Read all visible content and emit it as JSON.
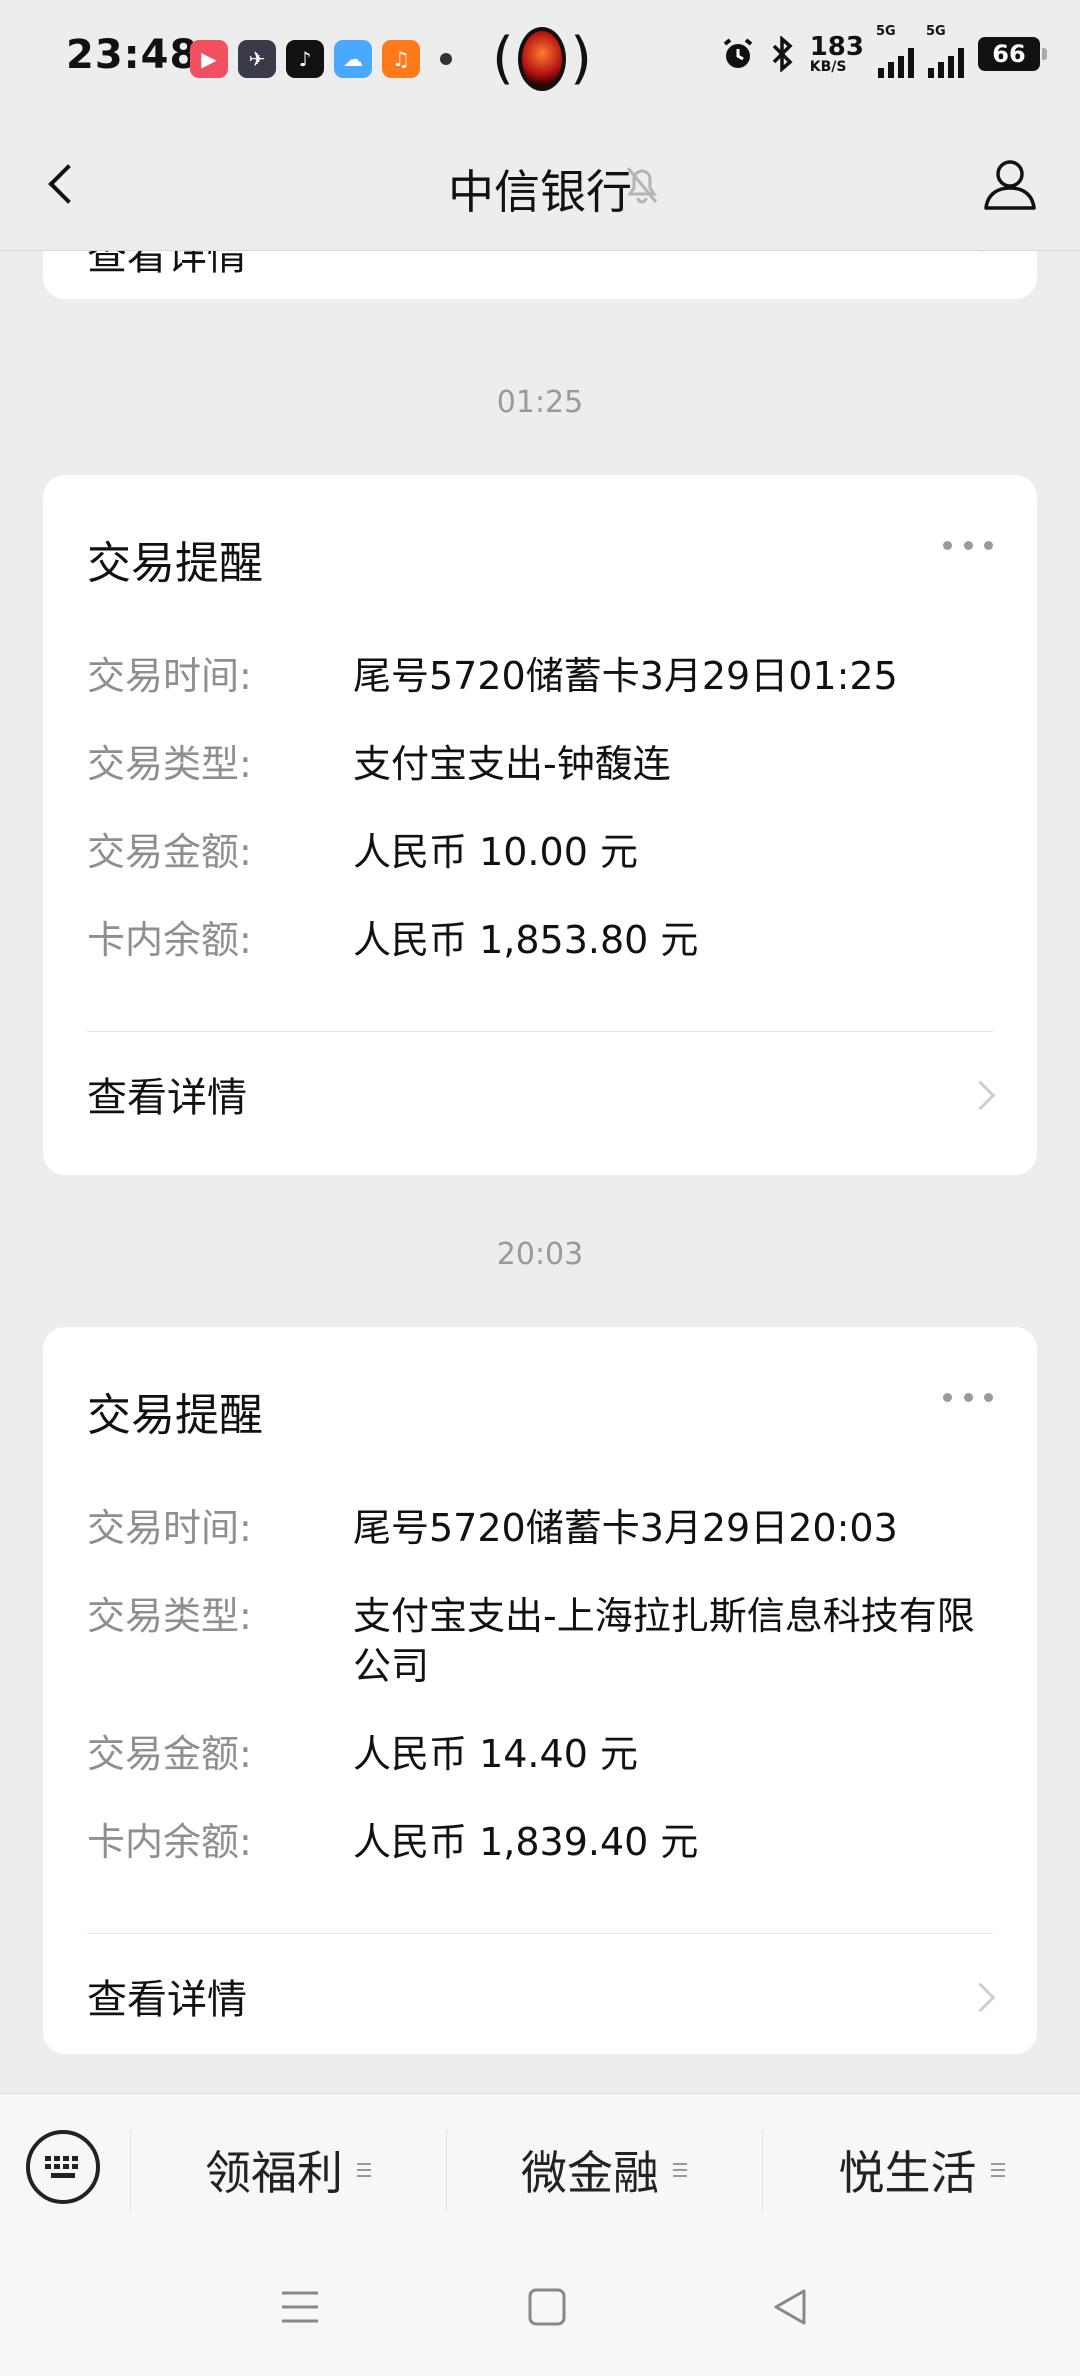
{
  "status_bar": {
    "time": "23:48",
    "apps": [
      {
        "icon": "video-app-icon",
        "color": "#f05060",
        "glyph": "▶"
      },
      {
        "icon": "running-app-icon",
        "color": "#3a3a4a",
        "glyph": "🏃"
      },
      {
        "icon": "tiktok-app-icon",
        "color": "#111111",
        "glyph": "♪"
      },
      {
        "icon": "weather-app-icon",
        "color": "#4aa8ff",
        "glyph": "☁"
      },
      {
        "icon": "orange-app-icon",
        "color": "#ff7a1a",
        "glyph": "♫"
      }
    ],
    "speed_value": "183",
    "speed_unit": "KB/S",
    "network1": "5G",
    "network2": "5G",
    "battery": "66"
  },
  "nav": {
    "title": "中信银行"
  },
  "partial_card": {
    "detail_label": "查看详情"
  },
  "messages": [
    {
      "timestamp": "01:25",
      "title": "交易提醒",
      "rows": [
        {
          "label": "交易时间:",
          "value": "尾号5720储蓄卡3月29日01:25"
        },
        {
          "label": "交易类型:",
          "value": "支付宝支出-钟馥连"
        },
        {
          "label": "交易金额:",
          "value": "人民币 10.00 元"
        },
        {
          "label": "卡内余额:",
          "value": "人民币 1,853.80 元"
        }
      ],
      "detail_label": "查看详情"
    },
    {
      "timestamp": "20:03",
      "title": "交易提醒",
      "rows": [
        {
          "label": "交易时间:",
          "value": "尾号5720储蓄卡3月29日20:03"
        },
        {
          "label": "交易类型:",
          "value": "支付宝支出-上海拉扎斯信息科技有限公司"
        },
        {
          "label": "交易金额:",
          "value": "人民币 14.40 元"
        },
        {
          "label": "卡内余额:",
          "value": "人民币 1,839.40 元"
        }
      ],
      "detail_label": "查看详情"
    }
  ],
  "menu": {
    "items": [
      {
        "label": "领福利"
      },
      {
        "label": "微金融"
      },
      {
        "label": "悦生活"
      }
    ]
  }
}
